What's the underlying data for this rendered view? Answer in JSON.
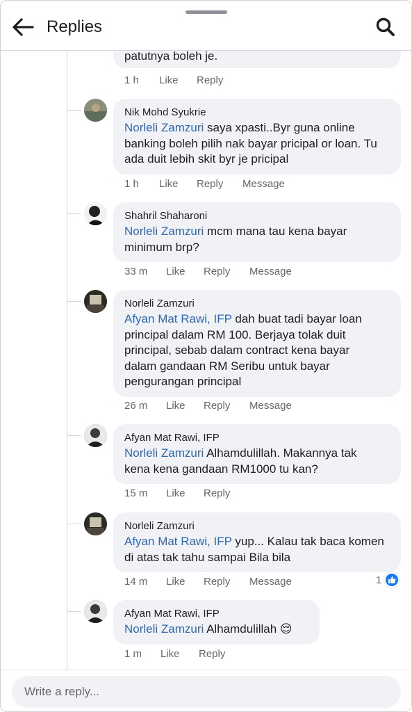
{
  "header": {
    "title": "Replies",
    "back_icon": "arrow-left-icon",
    "search_icon": "search-icon"
  },
  "colors": {
    "mention": "#2f67b0",
    "bubble": "#f0f2f5",
    "meta": "#65676b",
    "like_badge": "#1877f2"
  },
  "partial": {
    "text": "patutnya boleh je.",
    "time": "1 h",
    "like": "Like",
    "reply": "Reply"
  },
  "comments": [
    {
      "author": "Nik Mohd Syukrie",
      "mention": "Norleli Zamzuri",
      "lines": [
        " saya xpasti..Byr guna online",
        "banking boleh pilih nak bayar pricipal or loan. Tu",
        "ada duit lebih skit byr je pricipal"
      ],
      "time": "1 h",
      "like": "Like",
      "reply": "Reply",
      "message": "Message"
    },
    {
      "author": "Shahril Shaharoni",
      "mention": "Norleli Zamzuri",
      "lines": [
        " mcm mana tau kena bayar",
        "minimum brp?"
      ],
      "time": "33 m",
      "like": "Like",
      "reply": "Reply",
      "message": "Message"
    },
    {
      "author": "Norleli Zamzuri",
      "mention": "Afyan Mat Rawi, IFP",
      "lines": [
        " dah buat tadi bayar loan",
        "principal dalam RM 100. Berjaya tolak duit",
        "principal, sebab dalam contract kena bayar",
        "dalam gandaan RM Seribu untuk bayar",
        "pengurangan principal"
      ],
      "time": "26 m",
      "like": "Like",
      "reply": "Reply",
      "message": "Message"
    },
    {
      "author": "Afyan Mat Rawi, IFP",
      "mention": "Norleli Zamzuri",
      "lines": [
        " Alhamdulillah. Makannya tak",
        "kena kena gandaan RM1000 tu kan?"
      ],
      "time": "15 m",
      "like": "Like",
      "reply": "Reply"
    },
    {
      "author": "Norleli Zamzuri",
      "mention": "Afyan Mat Rawi, IFP",
      "lines": [
        " yup... Kalau tak baca komen",
        "di atas tak tahu sampai Bila bila"
      ],
      "time": "14 m",
      "like": "Like",
      "reply": "Reply",
      "message": "Message",
      "reaction_count": "1",
      "reaction_icon": "thumbs-up-icon"
    },
    {
      "author": "Afyan Mat Rawi, IFP",
      "mention": "Norleli Zamzuri",
      "lines": [
        " Alhamdulillah 😌"
      ],
      "time": "1 m",
      "like": "Like",
      "reply": "Reply"
    }
  ],
  "composer": {
    "placeholder": "Write a reply..."
  }
}
